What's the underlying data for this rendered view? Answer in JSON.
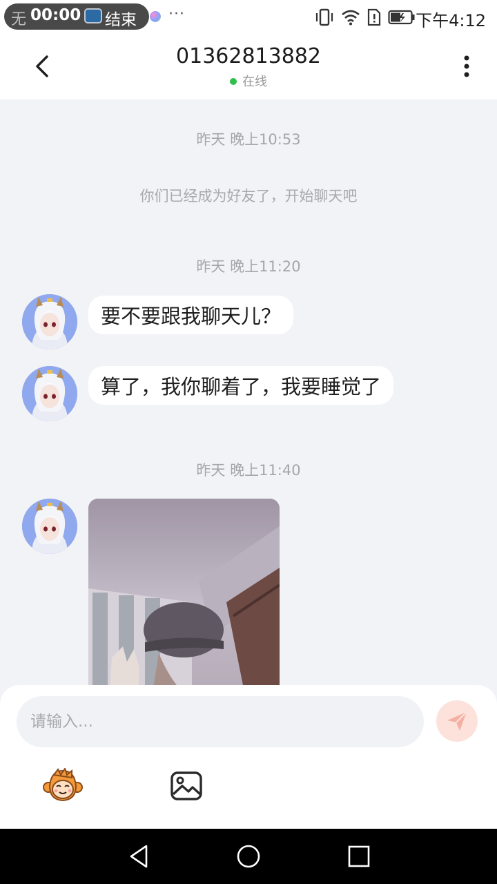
{
  "status_bar": {
    "recorder_bg_text": "无",
    "recorder_time": "00:00",
    "recorder_end_label": "结束",
    "more_dots": "···",
    "time": "下午4:12",
    "icons": [
      "vibrate-icon",
      "wifi-icon",
      "sim-alert-icon",
      "battery-charging-icon"
    ]
  },
  "header": {
    "title": "01362813882",
    "status": "在线",
    "status_color": "#2fbf4a"
  },
  "chat": {
    "timestamps": [
      "昨天 晚上10:53",
      "昨天 晚上11:20",
      "昨天 晚上11:40"
    ],
    "system_message": "你们已经成为好友了，开始聊天吧",
    "messages": [
      {
        "type": "text",
        "text": "要不要跟我聊天儿？"
      },
      {
        "type": "text",
        "text": "算了，我你聊着了，我要睡觉了"
      },
      {
        "type": "image"
      }
    ]
  },
  "composer": {
    "placeholder": "请输入...",
    "send_icon": "send-plane-icon",
    "emoji_icon": "monkey-emoji-icon",
    "image_icon": "picture-icon",
    "accent": "#f0a090"
  },
  "nav_bar": {
    "icons": [
      "nav-back-icon",
      "nav-home-icon",
      "nav-recent-icon"
    ]
  }
}
